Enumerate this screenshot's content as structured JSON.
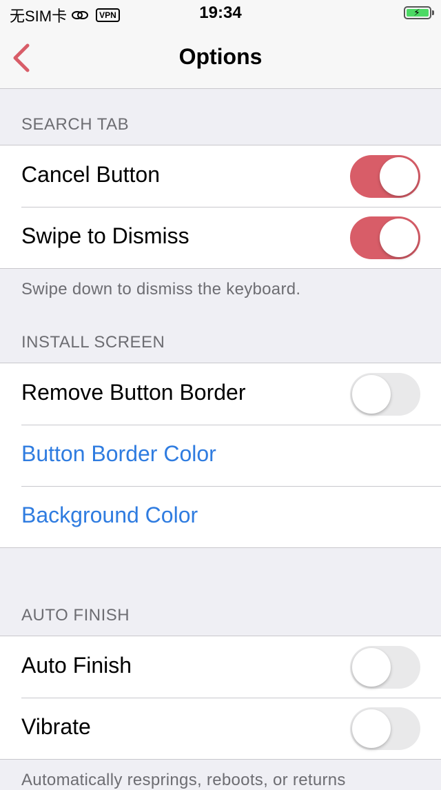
{
  "status_bar": {
    "carrier": "无SIM卡",
    "vpn": "VPN",
    "time": "19:34",
    "battery_color": "#4cd964"
  },
  "nav": {
    "title": "Options",
    "back_icon": "chevron-left-icon",
    "accent": "#d85d68"
  },
  "sections": {
    "search_tab": {
      "header": "SEARCH TAB",
      "rows": [
        {
          "label": "Cancel Button",
          "toggle": true
        },
        {
          "label": "Swipe to Dismiss",
          "toggle": true
        }
      ],
      "footer": "Swipe down to dismiss the keyboard."
    },
    "install_screen": {
      "header": "INSTALL SCREEN",
      "rows": [
        {
          "label": "Remove Button Border",
          "toggle": false
        },
        {
          "label": "Button Border Color"
        },
        {
          "label": "Background Color"
        }
      ]
    },
    "auto_finish": {
      "header": "AUTO FINISH",
      "rows": [
        {
          "label": "Auto Finish",
          "toggle": false
        },
        {
          "label": "Vibrate",
          "toggle": false
        }
      ],
      "footer": "Automatically resprings, reboots, or returns"
    }
  },
  "colors": {
    "link": "#2f7ce0",
    "toggle_on": "#d85d68",
    "toggle_off": "#e9e9ea"
  }
}
